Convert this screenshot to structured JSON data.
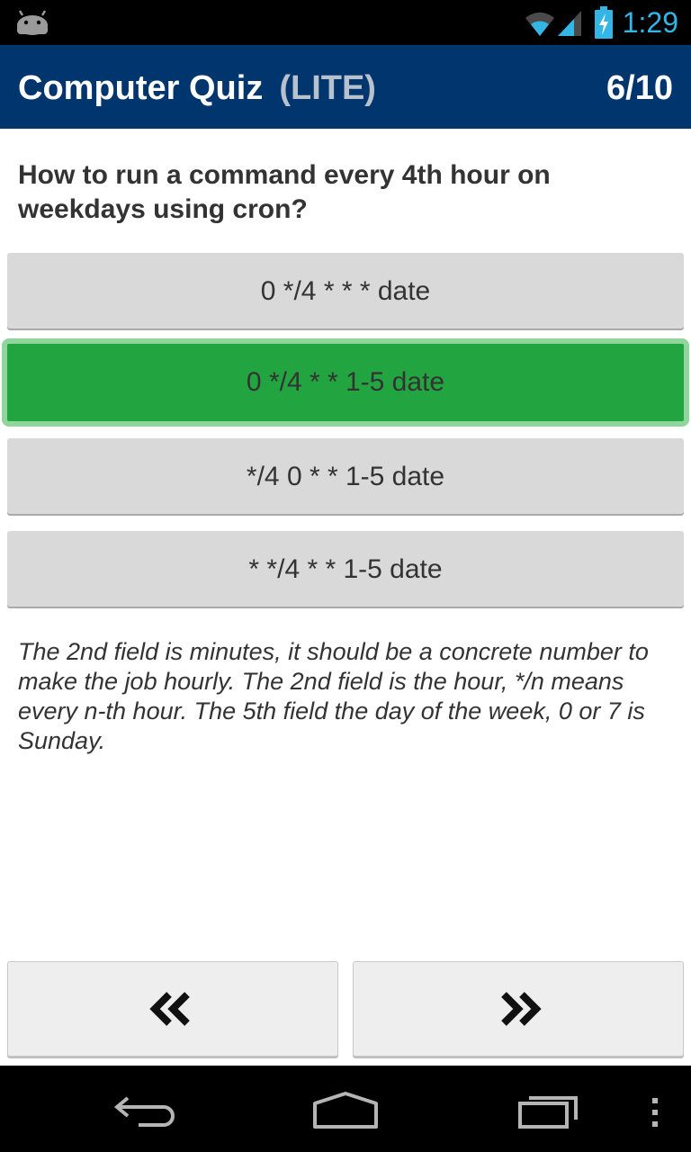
{
  "status_bar": {
    "time": "1:29",
    "icons": [
      "android-icon",
      "wifi-icon",
      "signal-icon",
      "battery-charging-icon"
    ]
  },
  "header": {
    "title": "Computer Quiz",
    "edition": "(LITE)",
    "progress": "6/10",
    "background_color": "#00356e"
  },
  "question": {
    "text": "How to run a command every 4th hour on weekdays using cron?"
  },
  "answers": [
    {
      "label": "0 */4 * * * date",
      "state": "default"
    },
    {
      "label": "0 */4 * * 1-5 date",
      "state": "correct"
    },
    {
      "label": "*/4 0 * * 1-5 date",
      "state": "default"
    },
    {
      "label": "* */4 * * 1-5 date",
      "state": "default"
    }
  ],
  "explanation": "The 2nd field is minutes, it should be a concrete number to make the job hourly. The 2nd field is the hour, */n means every n-th hour. The 5th field the day of the week, 0 or 7 is Sunday.",
  "navigation": {
    "previous_icon": "double-chevron-left-icon",
    "next_icon": "double-chevron-right-icon"
  },
  "system_nav": {
    "icons": [
      "back-icon",
      "home-icon",
      "recent-apps-icon",
      "overflow-menu-icon"
    ]
  },
  "colors": {
    "correct": "#22a540",
    "answer_default": "#d9d9d9",
    "status_time": "#33b5e5"
  }
}
